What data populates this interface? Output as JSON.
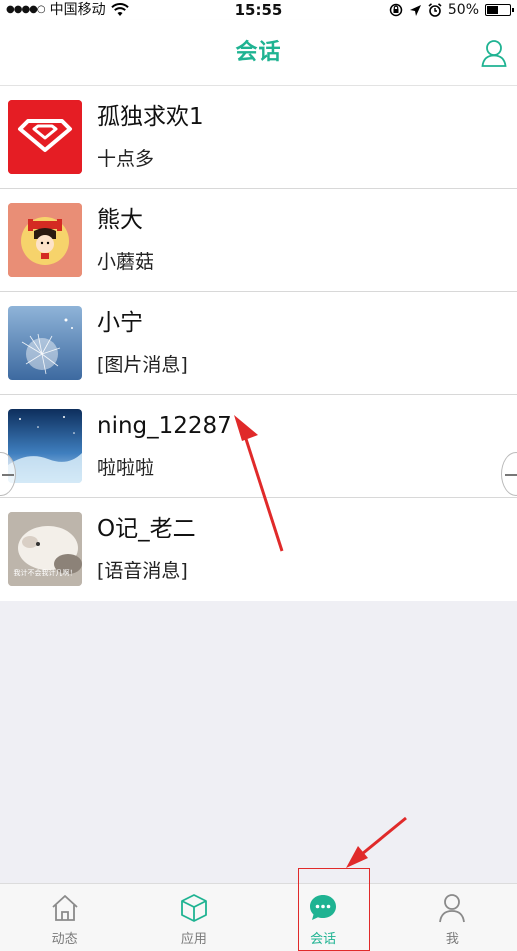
{
  "status_bar": {
    "signal": "●●●●○",
    "carrier": "中国移动",
    "time": "15:55",
    "battery": "50%",
    "battery_level": 0.5
  },
  "nav": {
    "title": "会话",
    "right_icon": "user-icon"
  },
  "conversations": [
    {
      "name": "孤独求欢1",
      "last_message": "十点多",
      "avatar": "red-diamond-logo"
    },
    {
      "name": "熊大",
      "last_message": "小蘑菇",
      "avatar": "cartoon-girl"
    },
    {
      "name": "小宁",
      "last_message": "[图片消息]",
      "avatar": "dandelion-photo"
    },
    {
      "name": "ning_12287",
      "last_message": "啦啦啦",
      "avatar": "blue-sky-photo"
    },
    {
      "name": "O记_老二",
      "last_message": "[语音消息]",
      "avatar": "hamster-photo",
      "avatar_caption": "我计不会我计几啊！"
    }
  ],
  "tabs": [
    {
      "label": "动态",
      "icon": "home-icon",
      "active": false
    },
    {
      "label": "应用",
      "icon": "cube-icon",
      "active": false
    },
    {
      "label": "会话",
      "icon": "chat-bubble-icon",
      "active": true
    },
    {
      "label": "我",
      "icon": "person-icon",
      "active": false
    }
  ],
  "colors": {
    "accent": "#1fb392",
    "annotation": "#e02a2a",
    "background": "#efeff4"
  }
}
